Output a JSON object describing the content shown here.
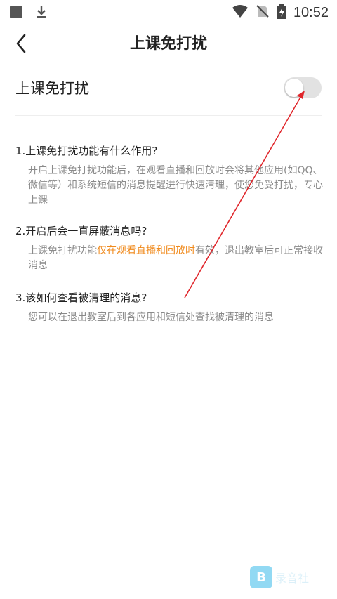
{
  "status_bar": {
    "time": "10:52"
  },
  "header": {
    "title": "上课免打扰"
  },
  "setting": {
    "label": "上课免打扰",
    "enabled": false
  },
  "faq": [
    {
      "question": "1.上课免打扰功能有什么作用?",
      "answer_parts": [
        "开启上课免打扰功能后，在观看直播和回放时会将其他应用(如QQ、微信等）和系统短信的消息提醒进行快速清理，使您免受打扰，专心上课"
      ]
    },
    {
      "question": "2.开启后会一直屏蔽消息吗?",
      "answer_before": "上课免打扰功能",
      "answer_highlight": "仅在观看直播和回放时",
      "answer_after": "有效，退出教室后可正常接收消息"
    },
    {
      "question": "3.该如何查看被清理的消息?",
      "answer_parts": [
        "您可以在退出教室后到各应用和短信处查找被清理的消息"
      ]
    }
  ],
  "colors": {
    "highlight": "#f08a1c",
    "annotation_arrow": "#e0262b",
    "watermark": "#7fd3f2"
  },
  "watermark": {
    "logo_letter": "B",
    "text": "录音社"
  }
}
